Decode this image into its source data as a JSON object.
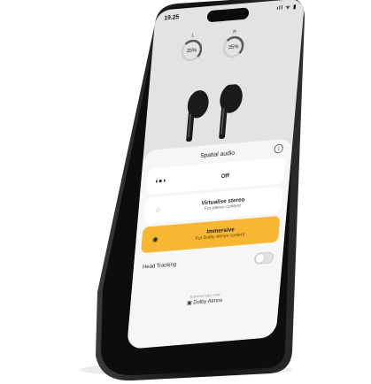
{
  "status_bar": {
    "time": "19.25",
    "icons": "ıll ᯤ ▮"
  },
  "battery": {
    "left": {
      "side": "L",
      "percent": "35%"
    },
    "right": {
      "side": "R",
      "percent": "35%"
    }
  },
  "sheet": {
    "title": "Spatial audio",
    "info_icon": "i",
    "options": [
      {
        "id": "off",
        "icon": "◖●◗",
        "title": "Off",
        "subtitle": "",
        "selected": false
      },
      {
        "id": "virtualise",
        "icon": "◌",
        "title": "Virtualise stereo",
        "subtitle": "For stereo content",
        "selected": false
      },
      {
        "id": "immersive",
        "icon": "◉",
        "title": "Immersive",
        "subtitle": "For Dolby Atmos content",
        "selected": true
      }
    ],
    "head_tracking": {
      "label": "Head Tracking",
      "enabled": false
    }
  },
  "dolby": {
    "supported_by": "SUPPORTED FOR",
    "brand": "▣ Dolby Atmos"
  },
  "colors": {
    "accent": "#f7b733",
    "phone_frame": "#1c1c1c"
  }
}
